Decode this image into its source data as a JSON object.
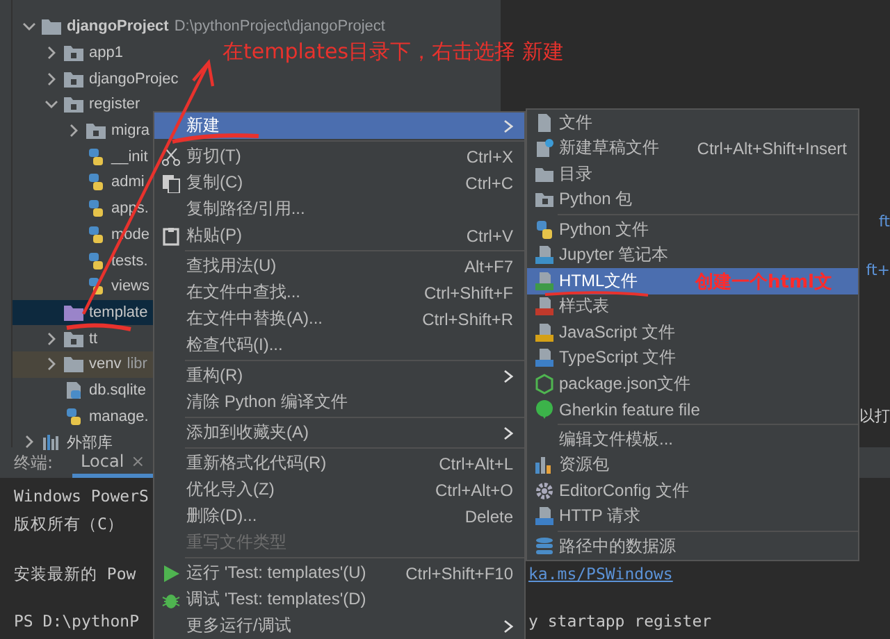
{
  "project_tree": {
    "items": [
      {
        "label": "djangoProject",
        "hint": "D:\\pythonProject\\djangoProject",
        "kind": "folder",
        "expanded": true,
        "selected": false,
        "excluded": false,
        "children": [
          {
            "label": "app1",
            "kind": "module",
            "expanded": false,
            "selected": false,
            "excluded": false
          },
          {
            "label": "djangoProjec",
            "kind": "module",
            "expanded": false,
            "selected": false,
            "excluded": false
          },
          {
            "label": "register",
            "kind": "module",
            "expanded": true,
            "selected": false,
            "excluded": false,
            "children": [
              {
                "label": "migra",
                "kind": "module",
                "expanded": false,
                "selected": false,
                "excluded": false
              },
              {
                "label": "__init",
                "kind": "python",
                "selected": false,
                "excluded": false
              },
              {
                "label": "admi",
                "kind": "python",
                "selected": false,
                "excluded": false
              },
              {
                "label": "apps.",
                "kind": "python",
                "selected": false,
                "excluded": false
              },
              {
                "label": "mode",
                "kind": "python",
                "selected": false,
                "excluded": false
              },
              {
                "label": "tests.",
                "kind": "python",
                "selected": false,
                "excluded": false
              },
              {
                "label": "views",
                "kind": "python",
                "selected": false,
                "excluded": false
              }
            ]
          },
          {
            "label": "template",
            "kind": "templates",
            "selected": true,
            "excluded": false
          },
          {
            "label": "tt",
            "kind": "module",
            "expanded": false,
            "selected": false,
            "excluded": false
          },
          {
            "label": "venv",
            "hint": "libr",
            "kind": "folder",
            "expanded": false,
            "selected": false,
            "excluded": true
          },
          {
            "label": "db.sqlite",
            "kind": "db",
            "selected": false,
            "excluded": false
          },
          {
            "label": "manage.",
            "kind": "python",
            "selected": false,
            "excluded": false
          }
        ]
      },
      {
        "label": "外部库",
        "kind": "library",
        "expanded": false,
        "selected": false,
        "excluded": false
      }
    ]
  },
  "editor": {
    "fragments": [
      {
        "text": "ft",
        "kind": "link"
      },
      {
        "text": "ft+",
        "kind": "link"
      },
      {
        "text": "以打",
        "kind": "plain"
      }
    ]
  },
  "tool_window": {
    "title": "终端:",
    "tabs": [
      {
        "label": "Local",
        "close": "×",
        "selected": true
      }
    ]
  },
  "terminal": {
    "lines": [
      {
        "text": "Windows PowerS"
      },
      {
        "text": "版权所有（C）"
      },
      {
        "text": "安装最新的 Pow",
        "tail": "ka.ms/PSWindows"
      },
      {
        "text": "PS D:\\pythonP",
        "tail": "y startapp register"
      }
    ]
  },
  "context_menu": {
    "items": [
      {
        "kind": "item",
        "label": "新建",
        "has_submenu": true,
        "selected": true,
        "disabled": false
      },
      {
        "kind": "separator"
      },
      {
        "kind": "item",
        "label": "剪切(T)",
        "shortcut": "Ctrl+X",
        "has_submenu": false,
        "selected": false,
        "disabled": false
      },
      {
        "kind": "item",
        "label": "复制(C)",
        "shortcut": "Ctrl+C",
        "has_submenu": false,
        "selected": false,
        "disabled": false
      },
      {
        "kind": "item",
        "label": "复制路径/引用...",
        "has_submenu": false,
        "selected": false,
        "disabled": false
      },
      {
        "kind": "item",
        "label": "粘贴(P)",
        "shortcut": "Ctrl+V",
        "has_submenu": false,
        "selected": false,
        "disabled": false
      },
      {
        "kind": "separator"
      },
      {
        "kind": "item",
        "label": "查找用法(U)",
        "shortcut": "Alt+F7",
        "has_submenu": false,
        "selected": false,
        "disabled": false
      },
      {
        "kind": "item",
        "label": "在文件中查找...",
        "shortcut": "Ctrl+Shift+F",
        "has_submenu": false,
        "selected": false,
        "disabled": false
      },
      {
        "kind": "item",
        "label": "在文件中替换(A)...",
        "shortcut": "Ctrl+Shift+R",
        "has_submenu": false,
        "selected": false,
        "disabled": false
      },
      {
        "kind": "item",
        "label": "检查代码(I)...",
        "has_submenu": false,
        "selected": false,
        "disabled": false
      },
      {
        "kind": "separator"
      },
      {
        "kind": "item",
        "label": "重构(R)",
        "has_submenu": true,
        "selected": false,
        "disabled": false
      },
      {
        "kind": "item",
        "label": "清除 Python 编译文件",
        "has_submenu": false,
        "selected": false,
        "disabled": false
      },
      {
        "kind": "separator"
      },
      {
        "kind": "item",
        "label": "添加到收藏夹(A)",
        "has_submenu": true,
        "selected": false,
        "disabled": false
      },
      {
        "kind": "separator"
      },
      {
        "kind": "item",
        "label": "重新格式化代码(R)",
        "shortcut": "Ctrl+Alt+L",
        "has_submenu": false,
        "selected": false,
        "disabled": false
      },
      {
        "kind": "item",
        "label": "优化导入(Z)",
        "shortcut": "Ctrl+Alt+O",
        "has_submenu": false,
        "selected": false,
        "disabled": false
      },
      {
        "kind": "item",
        "label": "删除(D)...",
        "shortcut": "Delete",
        "has_submenu": false,
        "selected": false,
        "disabled": false
      },
      {
        "kind": "item",
        "label": "重写文件类型",
        "has_submenu": false,
        "selected": false,
        "disabled": true
      },
      {
        "kind": "separator"
      },
      {
        "kind": "item",
        "label": "运行 'Test: templates'(U)",
        "shortcut": "Ctrl+Shift+F10",
        "has_submenu": false,
        "selected": false,
        "disabled": false
      },
      {
        "kind": "item",
        "label": "调试 'Test: templates'(D)",
        "has_submenu": false,
        "selected": false,
        "disabled": false
      },
      {
        "kind": "item",
        "label": "更多运行/调试",
        "has_submenu": true,
        "selected": false,
        "disabled": false
      }
    ]
  },
  "submenu": {
    "items": [
      {
        "kind": "item",
        "label": "文件",
        "selected": false
      },
      {
        "kind": "item",
        "label": "新建草稿文件",
        "shortcut": "Ctrl+Alt+Shift+Insert",
        "selected": false
      },
      {
        "kind": "item",
        "label": "目录",
        "selected": false
      },
      {
        "kind": "item",
        "label": "Python 包",
        "selected": false
      },
      {
        "kind": "separator"
      },
      {
        "kind": "item",
        "label": "Python 文件",
        "selected": false
      },
      {
        "kind": "item",
        "label": "Jupyter 笔记本",
        "selected": false
      },
      {
        "kind": "item",
        "label": "HTML文件",
        "selected": true
      },
      {
        "kind": "item",
        "label": "样式表",
        "selected": false
      },
      {
        "kind": "item",
        "label": "JavaScript 文件",
        "selected": false
      },
      {
        "kind": "item",
        "label": "TypeScript 文件",
        "selected": false
      },
      {
        "kind": "item",
        "label": "package.json文件",
        "selected": false
      },
      {
        "kind": "item",
        "label": "Gherkin feature file",
        "selected": false
      },
      {
        "kind": "separator"
      },
      {
        "kind": "item",
        "label": "编辑文件模板...",
        "selected": false
      },
      {
        "kind": "item",
        "label": "资源包",
        "selected": false
      },
      {
        "kind": "item",
        "label": "EditorConfig 文件",
        "selected": false
      },
      {
        "kind": "item",
        "label": "HTTP 请求",
        "selected": false
      },
      {
        "kind": "separator"
      },
      {
        "kind": "item",
        "label": "路径中的数据源",
        "selected": false
      }
    ]
  },
  "annotations": [
    {
      "text": "在templates目录下，右击选择 新建"
    },
    {
      "text": "创建一个html文"
    }
  ]
}
